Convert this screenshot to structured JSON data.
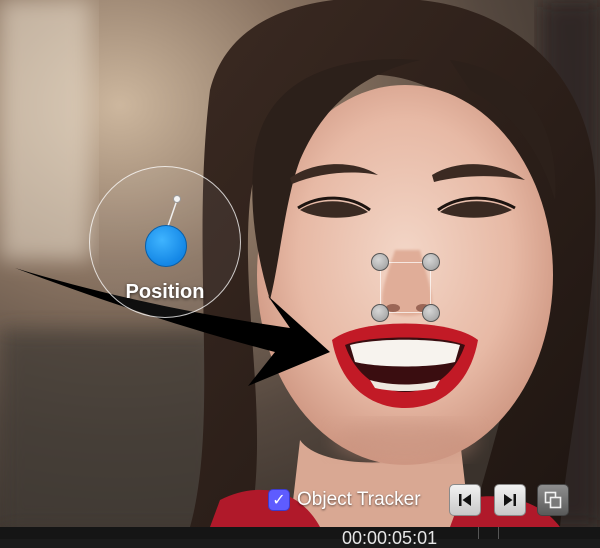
{
  "viewer": {
    "image": "smiling-woman-portrait",
    "position_label": "Position"
  },
  "tracker": {
    "checkbox_checked": true,
    "label": "Object Tracker",
    "checkbox_icon": "checkmark-icon",
    "prev_icon": "skip-backward-icon",
    "next_icon": "skip-forward-icon",
    "copy_icon": "copy-layers-icon"
  },
  "timebar": {
    "timecode": "00:00:05:01"
  },
  "colors": {
    "accent_blue": "#1487e6",
    "checkbox": "#5e5cff",
    "arrow": "#000000",
    "lips": "#c21a26"
  }
}
